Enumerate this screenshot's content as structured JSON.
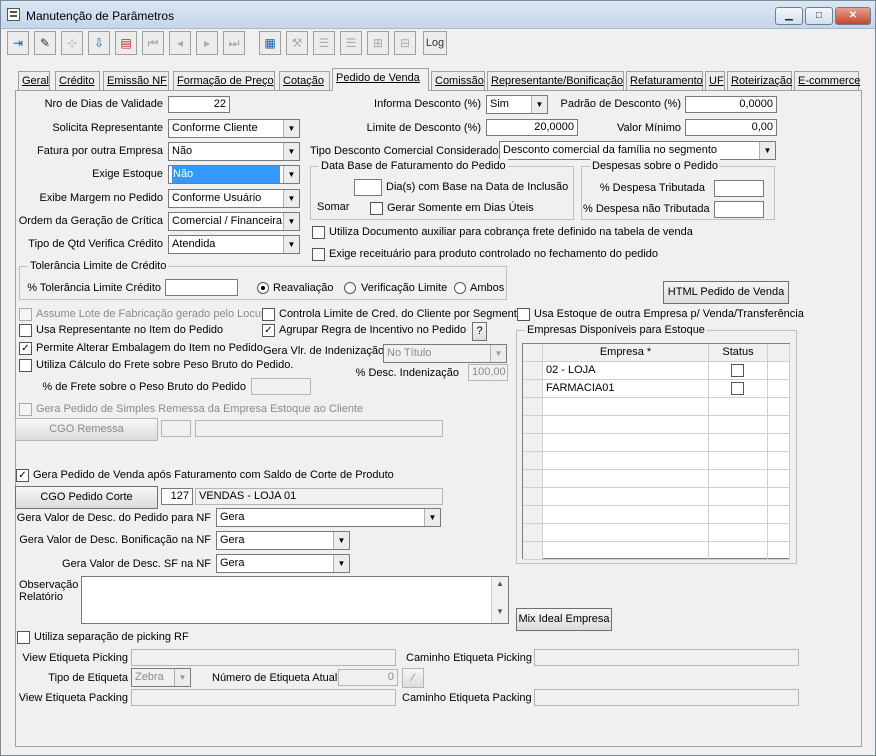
{
  "window": {
    "title": "Manutenção de Parâmetros",
    "min": "0",
    "max": "1",
    "close": "r"
  },
  "toolbar": {
    "log": "Log"
  },
  "tabs": [
    "Geral",
    "Crédito",
    "Emissão NF",
    "Formação de Preço",
    "Cotação",
    "Pedido de Venda",
    "Comissão",
    "Representante/Bonificação",
    "Refaturamento",
    "UF",
    "Roteirização",
    "E-commerce"
  ],
  "form": {
    "nro_dias_label": "Nro de Dias de Validade",
    "nro_dias_value": "22",
    "solicita_label": "Solicita Representante",
    "solicita_value": "Conforme Cliente",
    "fatura_label": "Fatura por outra Empresa",
    "fatura_value": "Não",
    "exige_label": "Exige Estoque",
    "exige_value": "Não",
    "margem_label": "Exibe Margem no Pedido",
    "margem_value": "Conforme Usuário",
    "ordem_label": "Ordem da Geração de Crítica",
    "ordem_value": "Comercial / Financeira",
    "tipo_qtd_label": "Tipo de Qtd Verifica Crédito",
    "tipo_qtd_value": "Atendida",
    "informa_desc_label": "Informa Desconto (%)",
    "informa_desc_value": "Sim",
    "padrao_desc_label": "Padrão de Desconto (%)",
    "padrao_desc_value": "0,0000",
    "limite_desc_label": "Limite de Desconto (%)",
    "limite_desc_value": "20,0000",
    "valor_min_label": "Valor Mínimo",
    "valor_min_value": "0,00",
    "tipo_desc_label": "Tipo Desconto Comercial Considerado",
    "tipo_desc_value": "Desconto comercial da família no segmento",
    "data_base_title": "Data Base de Faturamento do Pedido",
    "dias_label": "Dia(s)  com Base na Data de Inclusão",
    "somar": "Somar",
    "gerar_uteis": "Gerar Somente em Dias Úteis",
    "despesas_title": "Despesas sobre o Pedido",
    "desp_trib": "% Despesa Tributada",
    "desp_ntrib": "% Despesa não Tributada",
    "utiliza_doc": "Utiliza Documento auxiliar para cobrança frete definido na tabela de venda",
    "exige_receit": "Exige receituário para produto controlado no fechamento do pedido",
    "tolerancia_title": "Tolerância Limite de Crédito",
    "tolerancia_label": "% Tolerância Limite Crédito",
    "radio_reav": "Reavaliação",
    "radio_verif": "Verificação Limite",
    "radio_ambos": "Ambos",
    "html_btn": "HTML Pedido de Venda",
    "assume_lote": "Assume Lote de Fabricação gerado pelo Locus",
    "controla_limite": "Controla Limite de Cred. do Cliente por Segmento",
    "usa_estoque": "Usa Estoque de outra Empresa p/ Venda/Transferência",
    "usa_repr": "Usa Representante no Item do Pedido",
    "agrupar": "Agrupar Regra de Incentivo no Pedido",
    "help": "?",
    "permite_alt": "Permite Alterar Embalagem do Item no Pedido",
    "gera_vlr_label": "Gera Vlr. de Indenização",
    "gera_vlr_value": "No Título",
    "utiliza_calc": "Utiliza Cálculo do Frete sobre Peso Bruto do Pedido.",
    "desc_indeniz_label": "% Desc. Indenização",
    "desc_indeniz_value": "100,00",
    "frete_label": "% de Frete sobre o Peso Bruto do Pedido",
    "gera_simples": "Gera Pedido de Simples Remessa da Empresa Estoque ao Cliente",
    "cgo_remessa": "CGO Remessa",
    "gera_pedido": "Gera Pedido de Venda após Faturamento com Saldo de Corte de Produto",
    "cgo_corte": "CGO Pedido Corte",
    "cgo_corte_code": "127",
    "cgo_corte_desc": "VENDAS - LOJA 01",
    "gera_desc_pedido_label": "Gera Valor de Desc. do Pedido para NF",
    "gera_desc_pedido_value": "Gera",
    "gera_desc_bonif_label": "Gera Valor de Desc. Bonificação na NF",
    "gera_desc_bonif_value": "Gera",
    "gera_desc_sf_label": "Gera Valor de Desc. SF na NF",
    "gera_desc_sf_value": "Gera",
    "obs_label1": "Observação",
    "obs_label2": "Relatório",
    "mix_btn": "Mix Ideal Empresa",
    "utiliza_picking": "Utiliza separação de picking RF",
    "view_picking": "View Etiqueta Picking",
    "caminho_picking": "Caminho Etiqueta Picking",
    "tipo_etiq_label": "Tipo de Etiqueta",
    "tipo_etiq_value": "Zebra",
    "num_etiq_label": "Número de Etiqueta Atual",
    "num_etiq_value": "0",
    "view_packing": "View Etiqueta Packing",
    "caminho_packing": "Caminho Etiqueta Packing"
  },
  "empresas": {
    "title": "Empresas Disponíveis para Estoque",
    "col_empresa": "Empresa *",
    "col_status": "Status",
    "rows": [
      {
        "empresa": "02 - LOJA"
      },
      {
        "empresa": "FARMACIA01"
      }
    ]
  }
}
